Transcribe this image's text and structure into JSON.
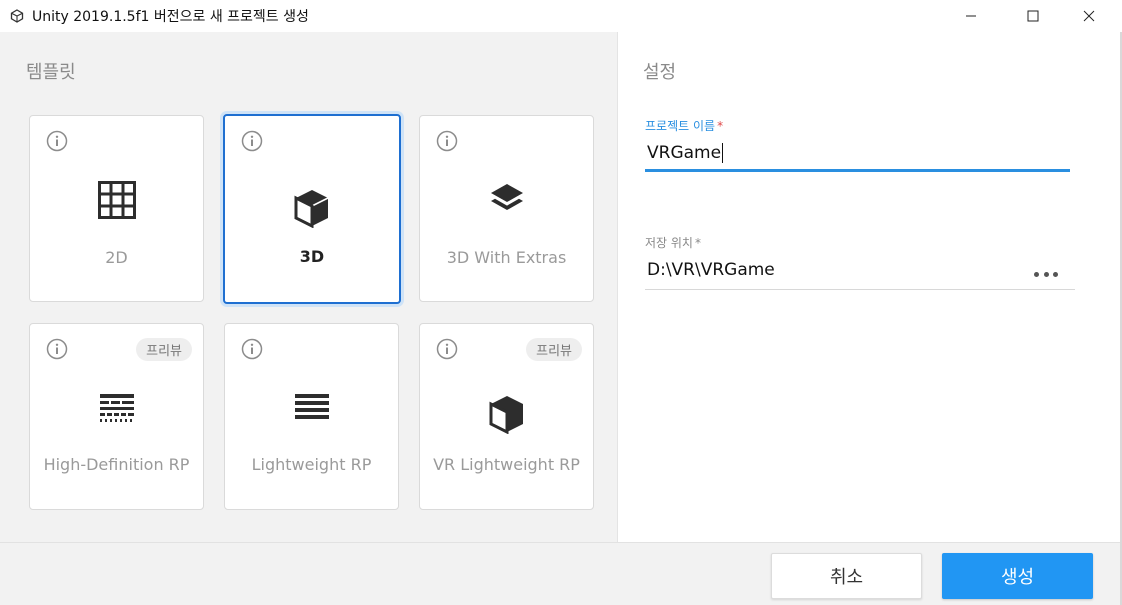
{
  "window": {
    "title": "Unity 2019.1.5f1 버전으로 새 프로젝트 생성",
    "icon": "unity-logo-icon",
    "controls": [
      "minimize-icon",
      "maximize-icon",
      "close-icon"
    ]
  },
  "templates": {
    "section_title": "템플릿",
    "items": [
      {
        "label": "2D",
        "icon": "grid-icon",
        "selected": false,
        "badge": ""
      },
      {
        "label": "3D",
        "icon": "cube-icon",
        "selected": true,
        "badge": ""
      },
      {
        "label": "3D With Extras",
        "icon": "layers-icon",
        "selected": false,
        "badge": ""
      },
      {
        "label": "High-Definition RP",
        "icon": "hdrp-lines-icon",
        "selected": false,
        "badge": "프리뷰"
      },
      {
        "label": "Lightweight RP",
        "icon": "lines-icon",
        "selected": false,
        "badge": ""
      },
      {
        "label": "VR Lightweight RP",
        "icon": "cube-icon",
        "selected": false,
        "badge": "프리뷰"
      }
    ]
  },
  "settings": {
    "section_title": "설정",
    "project_name": {
      "label": "프로젝트 이름",
      "required_mark": "*",
      "value": "VRGame"
    },
    "location": {
      "label": "저장 위치",
      "required_mark": "*",
      "value": "D:\\VR\\VRGame"
    }
  },
  "footer": {
    "cancel_label": "취소",
    "create_label": "생성"
  },
  "colors": {
    "accent": "#2196f3",
    "selected_border": "#1e6fd1",
    "required": "#e04848",
    "panel_bg": "#f2f2f2"
  }
}
